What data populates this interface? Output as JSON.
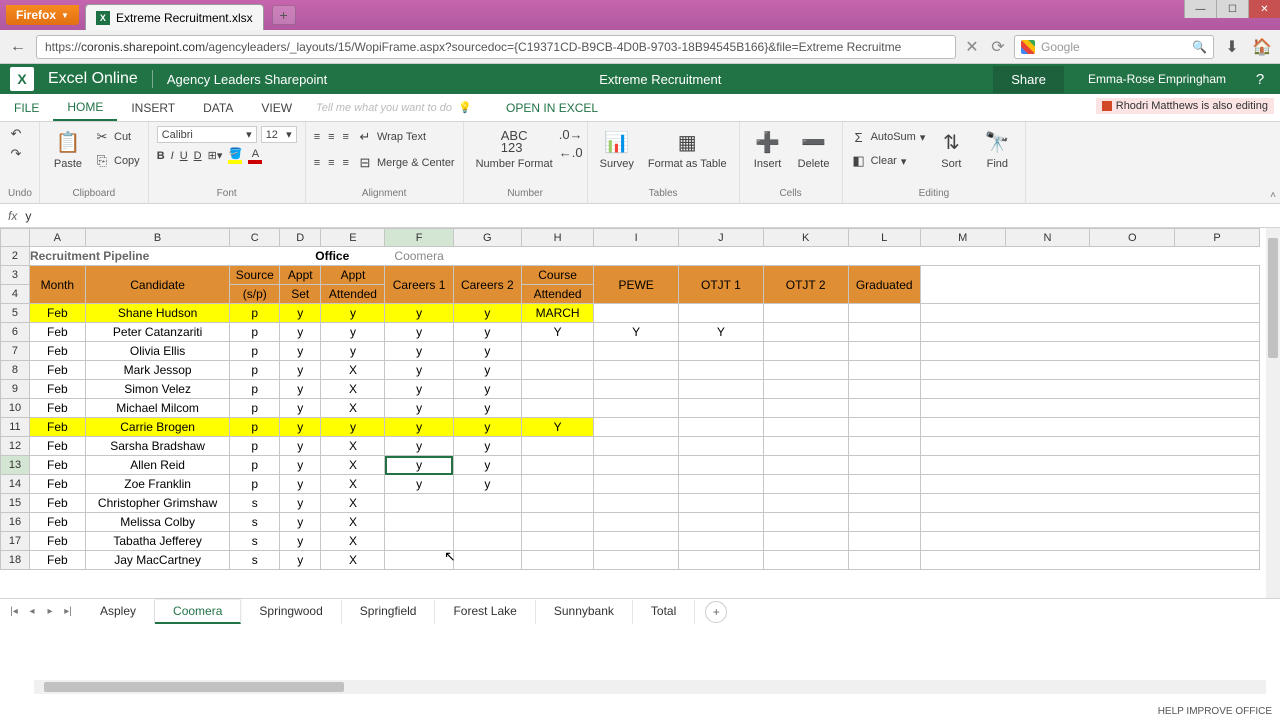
{
  "browser": {
    "name": "Firefox",
    "tab_title": "Extreme Recruitment.xlsx",
    "url_prefix": "https://",
    "url_domain": "coronis.sharepoint.com",
    "url_path": "/agencyleaders/_layouts/15/WopiFrame.aspx?sourcedoc={C19371CD-B9CB-4D0B-9703-18B94545B166}&file=Extreme Recruitme",
    "search_placeholder": "Google"
  },
  "app": {
    "name": "Excel Online",
    "site": "Agency Leaders Sharepoint",
    "doc": "Extreme Recruitment",
    "share": "Share",
    "user": "Emma-Rose Empringham",
    "coeditor": "Rhodri Matthews is also editing"
  },
  "ribbon_tabs": {
    "file": "FILE",
    "home": "HOME",
    "insert": "INSERT",
    "data": "DATA",
    "view": "VIEW",
    "tellme": "Tell me what you want to do",
    "open_in_excel": "OPEN IN EXCEL"
  },
  "ribbon": {
    "undo": "Undo",
    "paste": "Paste",
    "cut": "Cut",
    "copy": "Copy",
    "clipboard": "Clipboard",
    "font_name": "Calibri",
    "font_size": "12",
    "font_group": "Font",
    "wrap": "Wrap Text",
    "merge": "Merge & Center",
    "align_group": "Alignment",
    "numfmt": "Number Format",
    "num_group": "Number",
    "survey": "Survey",
    "fmttable": "Format as Table",
    "tables_group": "Tables",
    "insert": "Insert",
    "delete": "Delete",
    "cells_group": "Cells",
    "autosum": "AutoSum",
    "clear": "Clear",
    "sort": "Sort",
    "find": "Find",
    "editing_group": "Editing"
  },
  "formula": {
    "value": "y"
  },
  "columns": [
    "A",
    "B",
    "C",
    "D",
    "E",
    "F",
    "G",
    "H",
    "I",
    "J",
    "K",
    "L",
    "M",
    "N",
    "O",
    "P"
  ],
  "header_row1": {
    "D_E": "Office",
    "F": "Coomera",
    "A_left": "Recruitment Pipeline"
  },
  "headers": [
    "Month",
    "Candidate",
    "Source (s/p)",
    "Appt Set",
    "Appt Attended",
    "Careers 1",
    "Careers 2",
    "Course Attended",
    "PEWE",
    "OTJT 1",
    "OTJT 2",
    "Graduated"
  ],
  "rows": [
    {
      "n": 5,
      "hl": true,
      "d": [
        "Feb",
        "Shane Hudson",
        "p",
        "y",
        "y",
        "y",
        "y",
        "MARCH",
        "",
        "",
        "",
        ""
      ]
    },
    {
      "n": 6,
      "d": [
        "Feb",
        "Peter Catanzariti",
        "p",
        "y",
        "y",
        "y",
        "y",
        "Y",
        "Y",
        "Y",
        "",
        ""
      ]
    },
    {
      "n": 7,
      "d": [
        "Feb",
        "Olivia Ellis",
        "p",
        "y",
        "y",
        "y",
        "y",
        "",
        "",
        "",
        "",
        ""
      ]
    },
    {
      "n": 8,
      "d": [
        "Feb",
        "Mark Jessop",
        "p",
        "y",
        "X",
        "y",
        "y",
        "",
        "",
        "",
        "",
        ""
      ]
    },
    {
      "n": 9,
      "d": [
        "Feb",
        "Simon Velez",
        "p",
        "y",
        "X",
        "y",
        "y",
        "",
        "",
        "",
        "",
        ""
      ]
    },
    {
      "n": 10,
      "d": [
        "Feb",
        "Michael Milcom",
        "p",
        "y",
        "X",
        "y",
        "y",
        "",
        "",
        "",
        "",
        ""
      ]
    },
    {
      "n": 11,
      "hl": true,
      "hlto": 8,
      "d": [
        "Feb",
        "Carrie Brogen",
        "p",
        "y",
        "y",
        "y",
        "y",
        "Y",
        "",
        "",
        "",
        ""
      ]
    },
    {
      "n": 12,
      "d": [
        "Feb",
        "Sarsha Bradshaw",
        "p",
        "y",
        "X",
        "y",
        "y",
        "",
        "",
        "",
        "",
        ""
      ]
    },
    {
      "n": 13,
      "sel": true,
      "d": [
        "Feb",
        "Allen Reid",
        "p",
        "y",
        "X",
        "y",
        "y",
        "",
        "",
        "",
        "",
        ""
      ]
    },
    {
      "n": 14,
      "d": [
        "Feb",
        "Zoe Franklin",
        "p",
        "y",
        "X",
        "y",
        "y",
        "",
        "",
        "",
        "",
        ""
      ]
    },
    {
      "n": 15,
      "d": [
        "Feb",
        "Christopher Grimshaw",
        "s",
        "y",
        "X",
        "",
        "",
        "",
        "",
        "",
        "",
        ""
      ]
    },
    {
      "n": 16,
      "d": [
        "Feb",
        "Melissa Colby",
        "s",
        "y",
        "X",
        "",
        "",
        "",
        "",
        "",
        "",
        ""
      ]
    },
    {
      "n": 17,
      "d": [
        "Feb",
        "Tabatha Jefferey",
        "s",
        "y",
        "X",
        "",
        "",
        "",
        "",
        "",
        "",
        ""
      ]
    },
    {
      "n": 18,
      "d": [
        "Feb",
        "Jay MacCartney",
        "s",
        "y",
        "X",
        "",
        "",
        "",
        "",
        "",
        "",
        ""
      ]
    }
  ],
  "sheets": [
    "Aspley",
    "Coomera",
    "Springwood",
    "Springfield",
    "Forest Lake",
    "Sunnybank",
    "Total"
  ],
  "active_sheet": 1,
  "status": "HELP IMPROVE OFFICE",
  "selected_col": 5
}
